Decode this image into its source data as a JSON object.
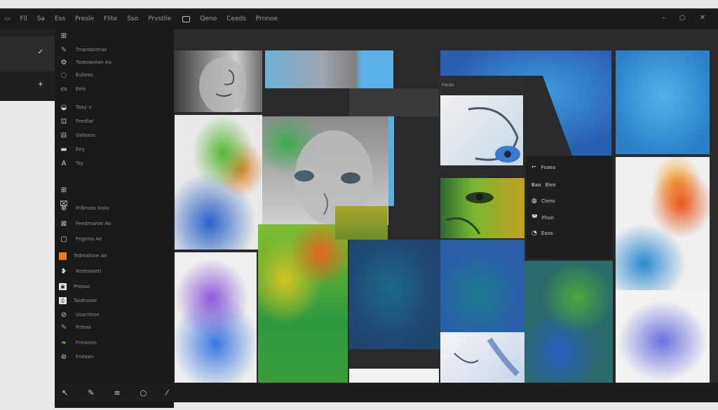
{
  "menu": {
    "items": [
      "Fll",
      "Sa",
      "Ess",
      "Presle",
      "Flite",
      "Sso",
      "Prvstlie",
      "Qeno",
      "Ceeds",
      "Prnnoe"
    ],
    "app_icon": "app-icon"
  },
  "window_controls": [
    "–",
    "○",
    "✕"
  ],
  "layers": {
    "row2_glyph": "✓",
    "row3_glyph": "+"
  },
  "tools": [
    {
      "icon": "frame-icon",
      "glyph": "⊞",
      "label": ""
    },
    {
      "icon": "brush-icon",
      "glyph": "✎",
      "label": "Tnandsntnar",
      "accent": "#66cc44"
    },
    {
      "icon": "gear-icon",
      "glyph": "⚙",
      "label": "Tsoeswolan Aa"
    },
    {
      "icon": "lasso-icon",
      "glyph": "◌",
      "label": "Euliess"
    },
    {
      "icon": "rect-icon",
      "glyph": "▭",
      "label": "Eels"
    },
    {
      "icon": "gauge-icon",
      "glyph": "◒",
      "label": "Taay  ∨"
    },
    {
      "icon": "crop-icon",
      "glyph": "⊡",
      "label": "Feedlar"
    },
    {
      "icon": "layers-icon",
      "glyph": "⊟",
      "label": "Ualaaos"
    },
    {
      "icon": "bar-icon",
      "glyph": "▬",
      "label": "Eey"
    },
    {
      "icon": "text-icon",
      "glyph": "A",
      "label": "Tsy"
    },
    {
      "icon": "grid-icon",
      "glyph": "⊞",
      "label": ""
    },
    {
      "icon": "fill-icon",
      "glyph": "⌧",
      "label": ""
    },
    {
      "icon": "link-icon",
      "glyph": "⊗",
      "label": "Frlbnoss  tosis"
    },
    {
      "icon": "copy-icon",
      "glyph": "⊠",
      "label": "Feedmaroe  Ao"
    },
    {
      "icon": "square-icon",
      "glyph": "▢",
      "label": "Fngnna  Ae"
    },
    {
      "icon": "swatch-icon",
      "glyph": "■",
      "label": "Trdnlalnne  An"
    },
    {
      "icon": "heart-icon",
      "glyph": "❥",
      "label": "Nretoosetr"
    },
    {
      "icon": "image-icon",
      "glyph": "▣",
      "label": "Preoso"
    },
    {
      "icon": "printer-icon",
      "glyph": "⎙",
      "label": "Taidlnooe"
    },
    {
      "icon": "eraser-icon",
      "glyph": "⊘",
      "label": "Uoanteoe"
    },
    {
      "icon": "pen-icon",
      "glyph": "✎",
      "label": "Frmoo",
      "accent": "#66cc44"
    },
    {
      "icon": "leaf-icon",
      "glyph": "❧",
      "label": "Fnnsoon",
      "accent": "#66cc44"
    },
    {
      "icon": "history-icon",
      "glyph": "⊜",
      "label": "Fnesan"
    }
  ],
  "bottom_bar": [
    "↖",
    "✎",
    "≡",
    "○",
    "⁄"
  ],
  "mini_panel": {
    "label": "Fxcso"
  },
  "side_panel": [
    {
      "icon": "frame-icon",
      "glyph": "⌐",
      "label": "Foaeo"
    },
    {
      "icon": "grid-icon",
      "glyph": "Bao",
      "label": "Bleo"
    },
    {
      "icon": "drop-icon",
      "glyph": "◍",
      "label": "Cleno"
    },
    {
      "icon": "bucket-icon",
      "glyph": "◚",
      "label": "Fhon"
    },
    {
      "icon": "search-icon",
      "glyph": "◔",
      "label": "Eaos"
    }
  ]
}
